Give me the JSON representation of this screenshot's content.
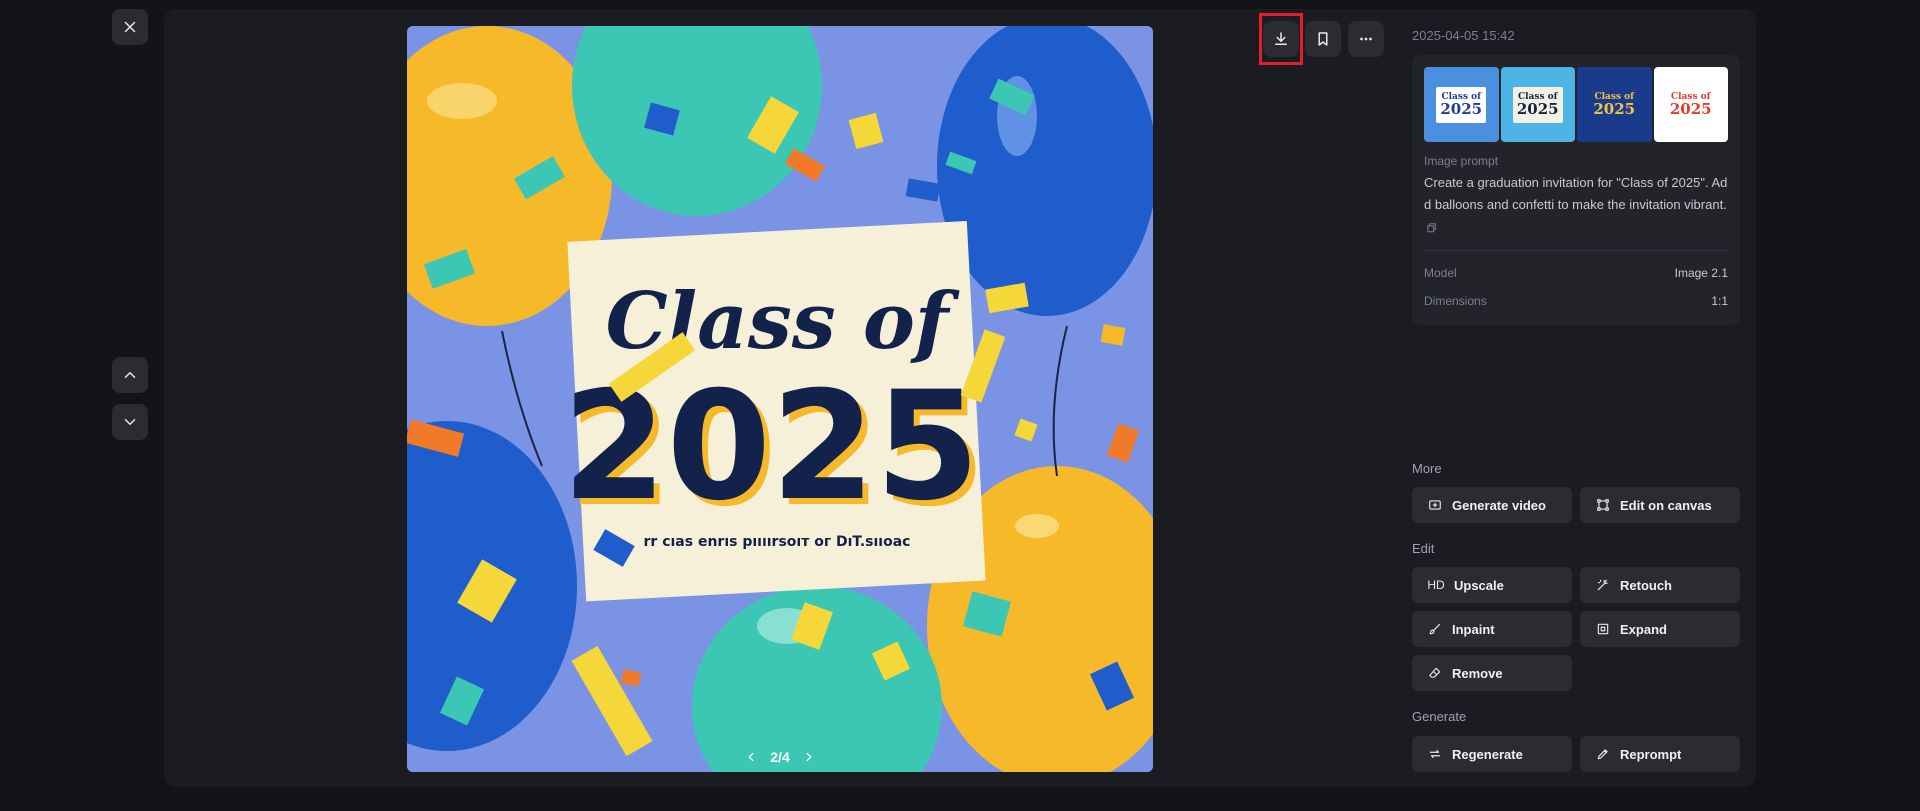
{
  "viewer": {
    "close_label": "close",
    "pager": {
      "current": "2/4"
    }
  },
  "image": {
    "headline": "Class of",
    "year": "2025",
    "subtext": "rr cıas enrıs pıııırsoıт oг DıT.sııoac"
  },
  "toolbar": {
    "download": "download",
    "bookmark": "bookmark",
    "more": "more"
  },
  "info": {
    "timestamp": "2025-04-05 15:42",
    "thumbnails": [
      {
        "line1": "Class of",
        "line2": "2025",
        "bg": "#4a8fe0",
        "card": "#ffffff",
        "text": "#1d3f8c"
      },
      {
        "line1": "Class of",
        "line2": "2025",
        "bg": "#4db4e6",
        "card": "#f4f1e3",
        "text": "#13224a"
      },
      {
        "line1": "Class of",
        "line2": "2025",
        "bg": "#1a3a8c",
        "card": "#1a3a8c",
        "text": "#f5c542"
      },
      {
        "line1": "Class of",
        "line2": "2025",
        "bg": "#ffffff",
        "card": "#ffffff",
        "text": "#e43b2c"
      }
    ],
    "prompt_label": "Image prompt",
    "prompt_text": "Create a graduation invitation for \"Class of 2025\". Add balloons and confetti to make the invitation vibrant.",
    "model_label": "Model",
    "model_value": "Image 2.1",
    "dimensions_label": "Dimensions",
    "dimensions_value": "1:1"
  },
  "sections": {
    "more": "More",
    "edit": "Edit",
    "generate": "Generate"
  },
  "actions": {
    "generate_video": "Generate video",
    "edit_on_canvas": "Edit on canvas",
    "upscale_prefix": "HD",
    "upscale": "Upscale",
    "retouch": "Retouch",
    "inpaint": "Inpaint",
    "expand": "Expand",
    "remove": "Remove",
    "regenerate": "Regenerate",
    "reprompt": "Reprompt"
  },
  "colors": {
    "background": "#131418",
    "panel": "#1b1c21",
    "button": "#2a2c32",
    "highlight": "#e01f2b",
    "image_bg": "#7b93e4"
  }
}
